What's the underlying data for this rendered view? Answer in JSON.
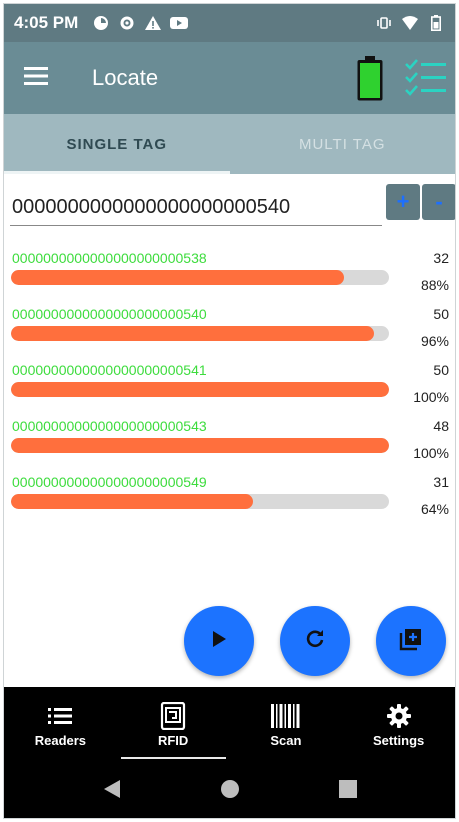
{
  "status_bar": {
    "time": "4:05 PM"
  },
  "app_bar": {
    "title": "Locate",
    "battery_color": "#2fd12f"
  },
  "tabs": [
    {
      "label": "SINGLE TAG",
      "active": true
    },
    {
      "label": "MULTI TAG",
      "active": false
    }
  ],
  "target": {
    "value": "0000000000000000000000540",
    "plus_label": "+",
    "minus_label": "-"
  },
  "tags": [
    {
      "id": "0000000000000000000000538",
      "rssi": "32",
      "percent_label": "88%",
      "percent": 88
    },
    {
      "id": "0000000000000000000000540",
      "rssi": "50",
      "percent_label": "96%",
      "percent": 96
    },
    {
      "id": "0000000000000000000000541",
      "rssi": "50",
      "percent_label": "100%",
      "percent": 100
    },
    {
      "id": "0000000000000000000000543",
      "rssi": "48",
      "percent_label": "100%",
      "percent": 100
    },
    {
      "id": "0000000000000000000000549",
      "rssi": "31",
      "percent_label": "64%",
      "percent": 64
    }
  ],
  "colors": {
    "accent": "#1c73ff",
    "bar_fill": "#ff6f3d",
    "tag_id": "#3ddc3d"
  },
  "bottom_nav": [
    {
      "label": "Readers",
      "icon": "list-icon"
    },
    {
      "label": "RFID",
      "icon": "rfid-icon",
      "active": true
    },
    {
      "label": "Scan",
      "icon": "barcode-icon"
    },
    {
      "label": "Settings",
      "icon": "gear-icon"
    }
  ]
}
